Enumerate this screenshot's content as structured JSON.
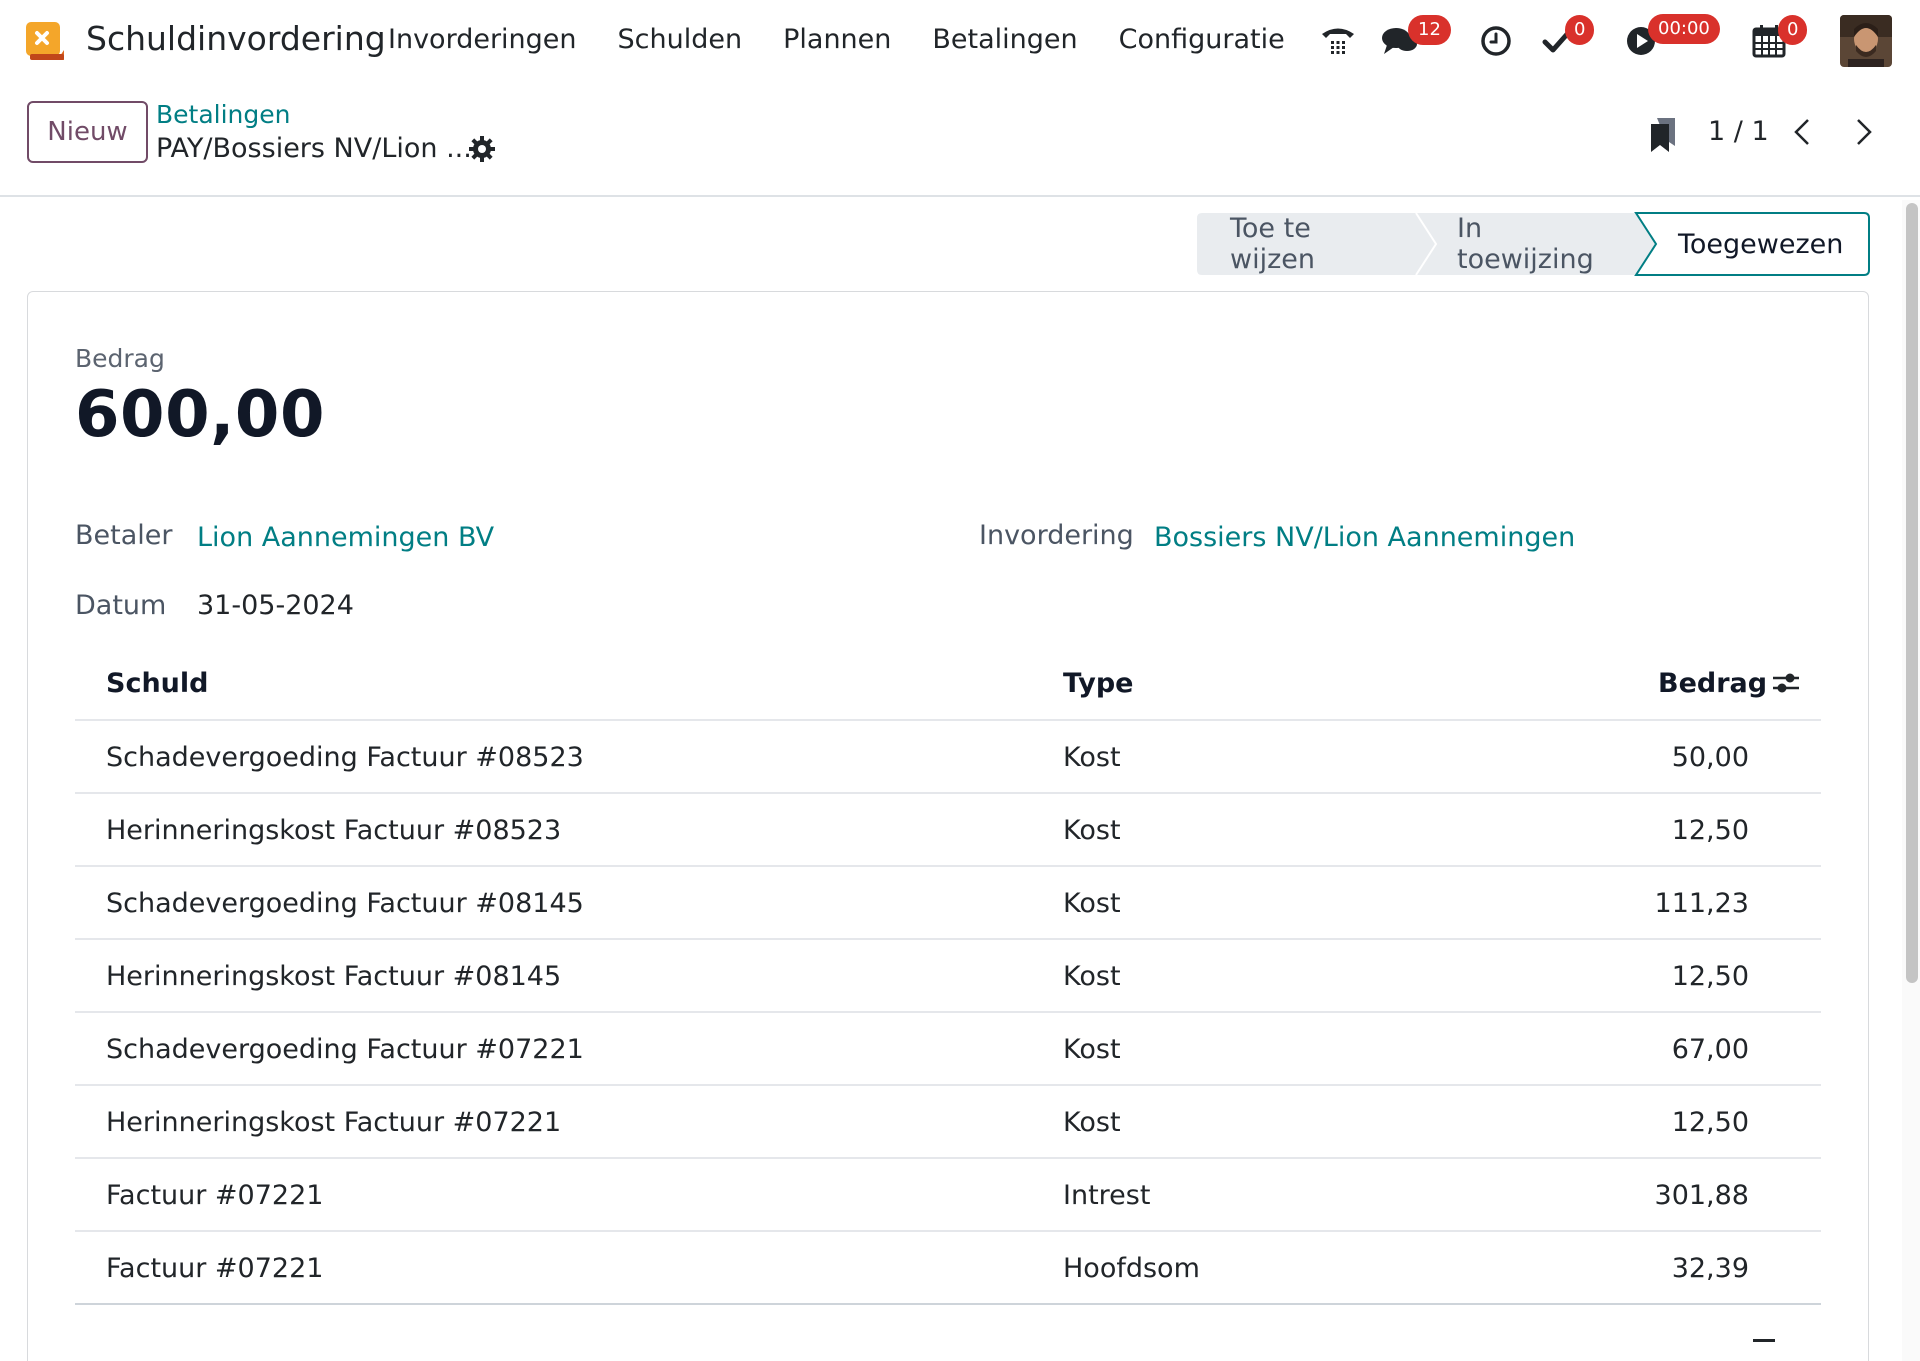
{
  "navbar": {
    "app_name": "Schuldinvordering",
    "menu": [
      "Invorderingen",
      "Schulden",
      "Plannen",
      "Betalingen",
      "Configuratie"
    ],
    "messages_count": "12",
    "activities_count": "0",
    "timer": "00:00",
    "calendar_count": "0"
  },
  "control_panel": {
    "new_label": "Nieuw",
    "breadcrumb": "Betalingen",
    "record_name": "PAY/Bossiers NV/Lion ...",
    "pager": "1 / 1"
  },
  "statusbar": {
    "steps": [
      "Toe te wijzen",
      "In toewijzing",
      "Toegewezen"
    ],
    "active": "Toegewezen"
  },
  "form": {
    "amount_label": "Bedrag",
    "amount": "600,00",
    "payer_label": "Betaler",
    "payer": "Lion Aannemingen BV",
    "collection_label": "Invordering",
    "collection": "Bossiers NV/Lion Aannemingen",
    "date_label": "Datum",
    "date": "31-05-2024"
  },
  "table": {
    "headers": {
      "debt": "Schuld",
      "type": "Type",
      "amount": "Bedrag"
    },
    "rows": [
      {
        "debt": "Schadevergoeding Factuur #08523",
        "type": "Kost",
        "amount": "50,00"
      },
      {
        "debt": "Herinneringskost Factuur #08523",
        "type": "Kost",
        "amount": "12,50"
      },
      {
        "debt": "Schadevergoeding Factuur #08145",
        "type": "Kost",
        "amount": "111,23"
      },
      {
        "debt": "Herinneringskost Factuur #08145",
        "type": "Kost",
        "amount": "12,50"
      },
      {
        "debt": "Schadevergoeding Factuur #07221",
        "type": "Kost",
        "amount": "67,00"
      },
      {
        "debt": "Herinneringskost Factuur #07221",
        "type": "Kost",
        "amount": "12,50"
      },
      {
        "debt": "Factuur #07221",
        "type": "Intrest",
        "amount": "301,88"
      },
      {
        "debt": "Factuur #07221",
        "type": "Hoofdsom",
        "amount": "32,39"
      }
    ]
  },
  "colors": {
    "brand": "#714b67",
    "link": "#017e84",
    "badge": "#d9312b"
  }
}
